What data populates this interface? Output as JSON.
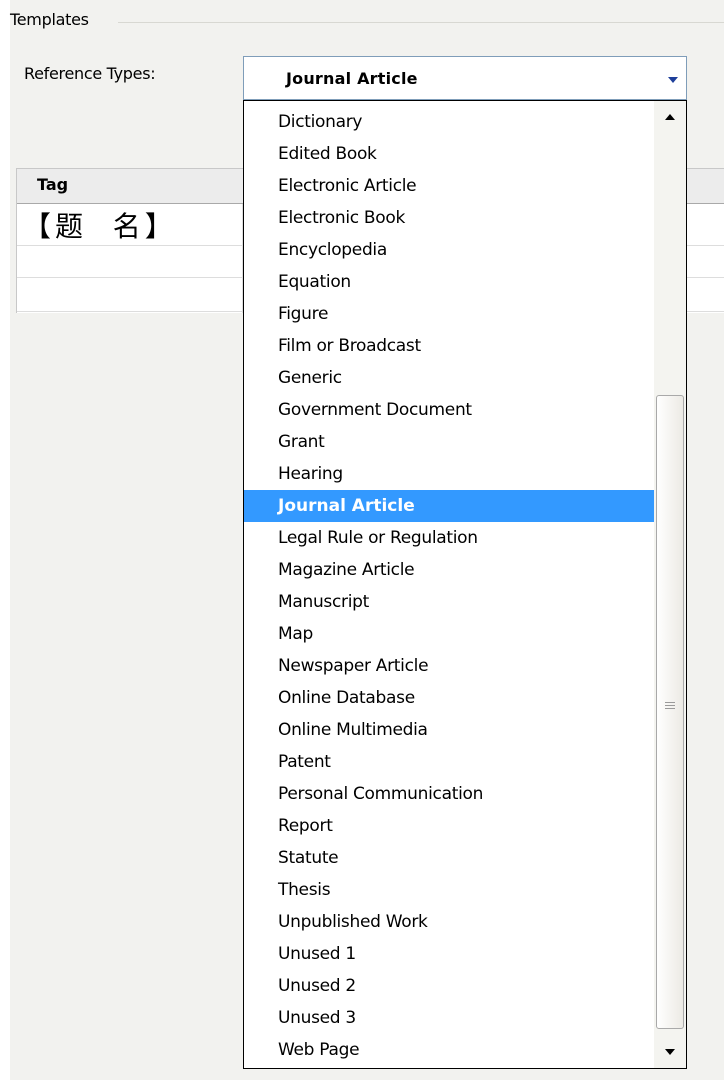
{
  "templates": {
    "group_label": "Templates",
    "reference_types_label": "Reference Types:",
    "selected_type": "Journal Article"
  },
  "grid": {
    "header_tag": "Tag",
    "first_tag": "【题  名】"
  },
  "dropdown": {
    "items": [
      "Dictionary",
      "Edited Book",
      "Electronic Article",
      "Electronic Book",
      "Encyclopedia",
      "Equation",
      "Figure",
      "Film or Broadcast",
      "Generic",
      "Government Document",
      "Grant",
      "Hearing",
      "Journal Article",
      "Legal Rule or Regulation",
      "Magazine Article",
      "Manuscript",
      "Map",
      "Newspaper Article",
      "Online Database",
      "Online Multimedia",
      "Patent",
      "Personal Communication",
      "Report",
      "Statute",
      "Thesis",
      "Unpublished Work",
      "Unused 1",
      "Unused 2",
      "Unused 3",
      "Web Page"
    ],
    "selected_index": 12
  },
  "colors": {
    "selection": "#3399ff",
    "combo_border": "#7f9db9",
    "dialog_background": "#f2f2ef"
  },
  "icons": {
    "combo_arrow": "chevron-down-icon",
    "scroll_up": "scroll-up-arrow-icon",
    "scroll_down": "scroll-down-arrow-icon",
    "thumb_grip": "grip-icon"
  }
}
